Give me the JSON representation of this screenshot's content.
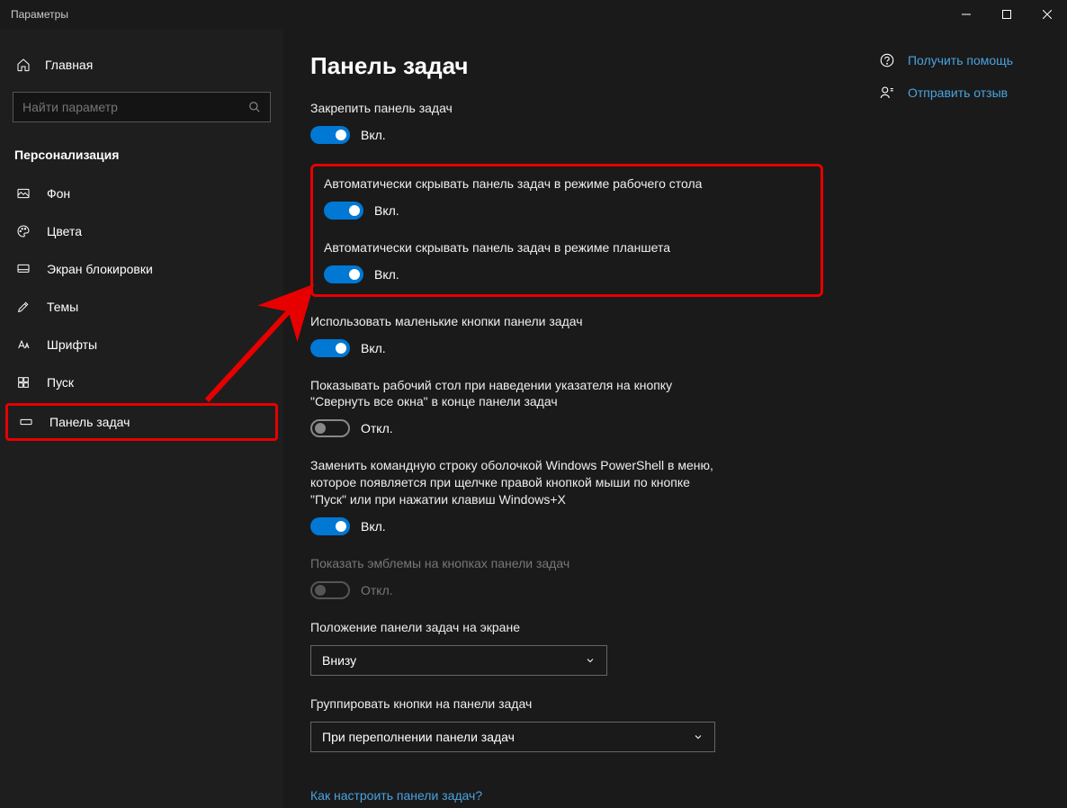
{
  "window": {
    "title": "Параметры"
  },
  "sidebar": {
    "home": "Главная",
    "search_placeholder": "Найти параметр",
    "section": "Персонализация",
    "items": [
      {
        "label": "Фон"
      },
      {
        "label": "Цвета"
      },
      {
        "label": "Экран блокировки"
      },
      {
        "label": "Темы"
      },
      {
        "label": "Шрифты"
      },
      {
        "label": "Пуск"
      },
      {
        "label": "Панель задач"
      }
    ]
  },
  "page": {
    "title": "Панель задач",
    "settings": {
      "lock": {
        "label": "Закрепить панель задач",
        "state": "Вкл."
      },
      "autohide_desktop": {
        "label": "Автоматически скрывать панель задач в режиме рабочего стола",
        "state": "Вкл."
      },
      "autohide_tablet": {
        "label": "Автоматически скрывать панель задач в режиме планшета",
        "state": "Вкл."
      },
      "small_buttons": {
        "label": "Использовать маленькие кнопки панели задач",
        "state": "Вкл."
      },
      "peek_desktop": {
        "label": "Показывать рабочий стол при наведении указателя на кнопку \"Свернуть все окна\" в конце панели задач",
        "state": "Откл."
      },
      "powershell": {
        "label": "Заменить командную строку оболочкой Windows PowerShell в меню, которое появляется при щелчке правой кнопкой мыши по кнопке \"Пуск\" или при нажатии клавиш Windows+X",
        "state": "Вкл."
      },
      "badges": {
        "label": "Показать эмблемы на кнопках панели задач",
        "state": "Откл."
      },
      "position": {
        "label": "Положение панели задач на экране",
        "value": "Внизу"
      },
      "combine": {
        "label": "Группировать кнопки на панели задач",
        "value": "При переполнении панели задач"
      }
    },
    "footer_link": "Как настроить панели задач?"
  },
  "aside": {
    "help": "Получить помощь",
    "feedback": "Отправить отзыв"
  }
}
